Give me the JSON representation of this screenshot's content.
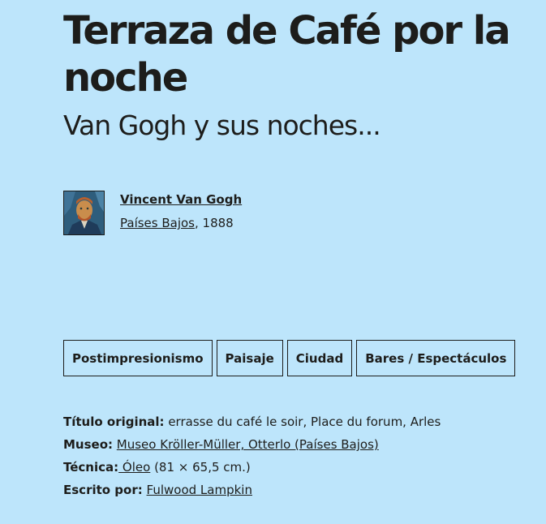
{
  "artwork": {
    "title": "Terraza de Café por la noche",
    "subtitle": "Van Gogh y sus noches..."
  },
  "artist": {
    "name": "Vincent Van Gogh",
    "country": "Países Bajos",
    "year_suffix": ", 1888",
    "portrait_icon": "van-gogh-self-portrait"
  },
  "tags": [
    "Postimpresionismo",
    "Paisaje",
    "Ciudad",
    "Bares / Espectáculos"
  ],
  "details": {
    "original_title_label": "Título original:",
    "original_title_value": " errasse du café le soir, Place du forum, Arles",
    "museum_label": "Museo:",
    "museum_value": "Museo Kröller-Müller, Otterlo (Países Bajos)",
    "technique_label": "Técnica:",
    "technique_link": " Óleo",
    "technique_dims": " (81 × 65,5 cm.)",
    "author_label": "Escrito por:",
    "author_value": "Fulwood Lampkin"
  },
  "colors": {
    "background": "#bde5fb",
    "text": "#1d1d1b"
  }
}
